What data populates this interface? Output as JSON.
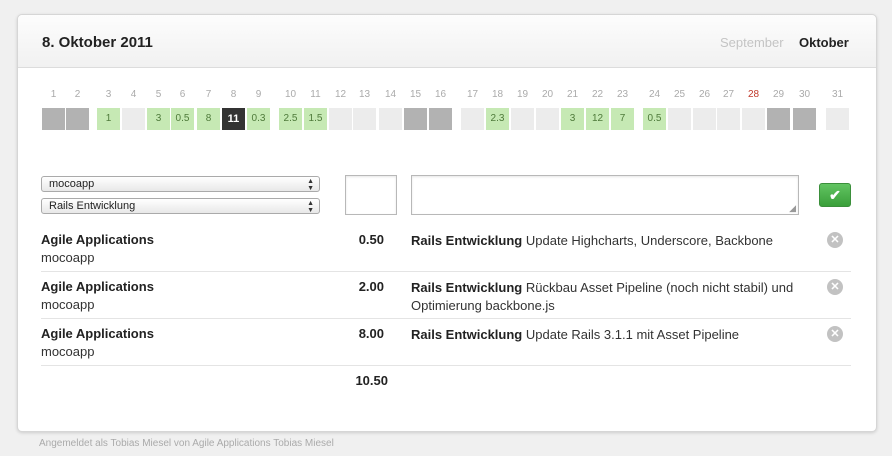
{
  "header": {
    "title": "8. Oktober 2011",
    "prev_month": "September",
    "current_month": "Oktober"
  },
  "calendar": {
    "days": [
      {
        "day": "1",
        "state": "weekend",
        "value": ""
      },
      {
        "day": "2",
        "state": "weekend",
        "value": ""
      },
      {
        "day": "3",
        "state": "logged",
        "value": "1"
      },
      {
        "day": "4",
        "state": "empty",
        "value": ""
      },
      {
        "day": "5",
        "state": "logged",
        "value": "3"
      },
      {
        "day": "6",
        "state": "logged",
        "value": "0.5"
      },
      {
        "day": "7",
        "state": "logged",
        "value": "8"
      },
      {
        "day": "8",
        "state": "selected",
        "value": "11"
      },
      {
        "day": "9",
        "state": "logged",
        "value": "0.3"
      },
      {
        "day": "10",
        "state": "logged",
        "value": "2.5"
      },
      {
        "day": "11",
        "state": "logged",
        "value": "1.5"
      },
      {
        "day": "12",
        "state": "empty",
        "value": ""
      },
      {
        "day": "13",
        "state": "empty",
        "value": ""
      },
      {
        "day": "14",
        "state": "empty",
        "value": ""
      },
      {
        "day": "15",
        "state": "weekend",
        "value": ""
      },
      {
        "day": "16",
        "state": "weekend",
        "value": ""
      },
      {
        "day": "17",
        "state": "empty",
        "value": ""
      },
      {
        "day": "18",
        "state": "logged",
        "value": "2.3"
      },
      {
        "day": "19",
        "state": "empty",
        "value": ""
      },
      {
        "day": "20",
        "state": "empty",
        "value": ""
      },
      {
        "day": "21",
        "state": "logged",
        "value": "3"
      },
      {
        "day": "22",
        "state": "logged",
        "value": "12"
      },
      {
        "day": "23",
        "state": "logged",
        "value": "7"
      },
      {
        "day": "24",
        "state": "logged",
        "value": "0.5"
      },
      {
        "day": "25",
        "state": "empty",
        "value": ""
      },
      {
        "day": "26",
        "state": "empty",
        "value": ""
      },
      {
        "day": "27",
        "state": "empty",
        "value": ""
      },
      {
        "day": "28",
        "state": "empty",
        "value": "",
        "today": true
      },
      {
        "day": "29",
        "state": "weekend",
        "value": ""
      },
      {
        "day": "30",
        "state": "weekend",
        "value": ""
      },
      {
        "day": "31",
        "state": "empty",
        "value": ""
      }
    ]
  },
  "form": {
    "customer_select": "mocoapp",
    "task_select": "Rails Entwicklung",
    "hours_value": "",
    "description_value": "",
    "submit_icon": "check-icon"
  },
  "entries": [
    {
      "customer": "Agile Applications",
      "project": "mocoapp",
      "hours": "0.50",
      "task": "Rails Entwicklung",
      "description": "Update Highcharts, Underscore, Backbone"
    },
    {
      "customer": "Agile Applications",
      "project": "mocoapp",
      "hours": "2.00",
      "task": "Rails Entwicklung",
      "description": "Rückbau Asset Pipeline (noch nicht stabil) und Optimierung backbone.js"
    },
    {
      "customer": "Agile Applications",
      "project": "mocoapp",
      "hours": "8.00",
      "task": "Rails Entwicklung",
      "description": "Update Rails 3.1.1 mit Asset Pipeline"
    }
  ],
  "total": "10.50",
  "footer": {
    "text": "Angemeldet als Tobias Miesel von Agile Applications Tobias Miesel"
  },
  "colors": {
    "logged": "#c6e9b4",
    "weekend": "#b2b2b2",
    "empty": "#ececec",
    "selected": "#333333",
    "today": "#c0392b",
    "ok": "#4cae4c"
  }
}
